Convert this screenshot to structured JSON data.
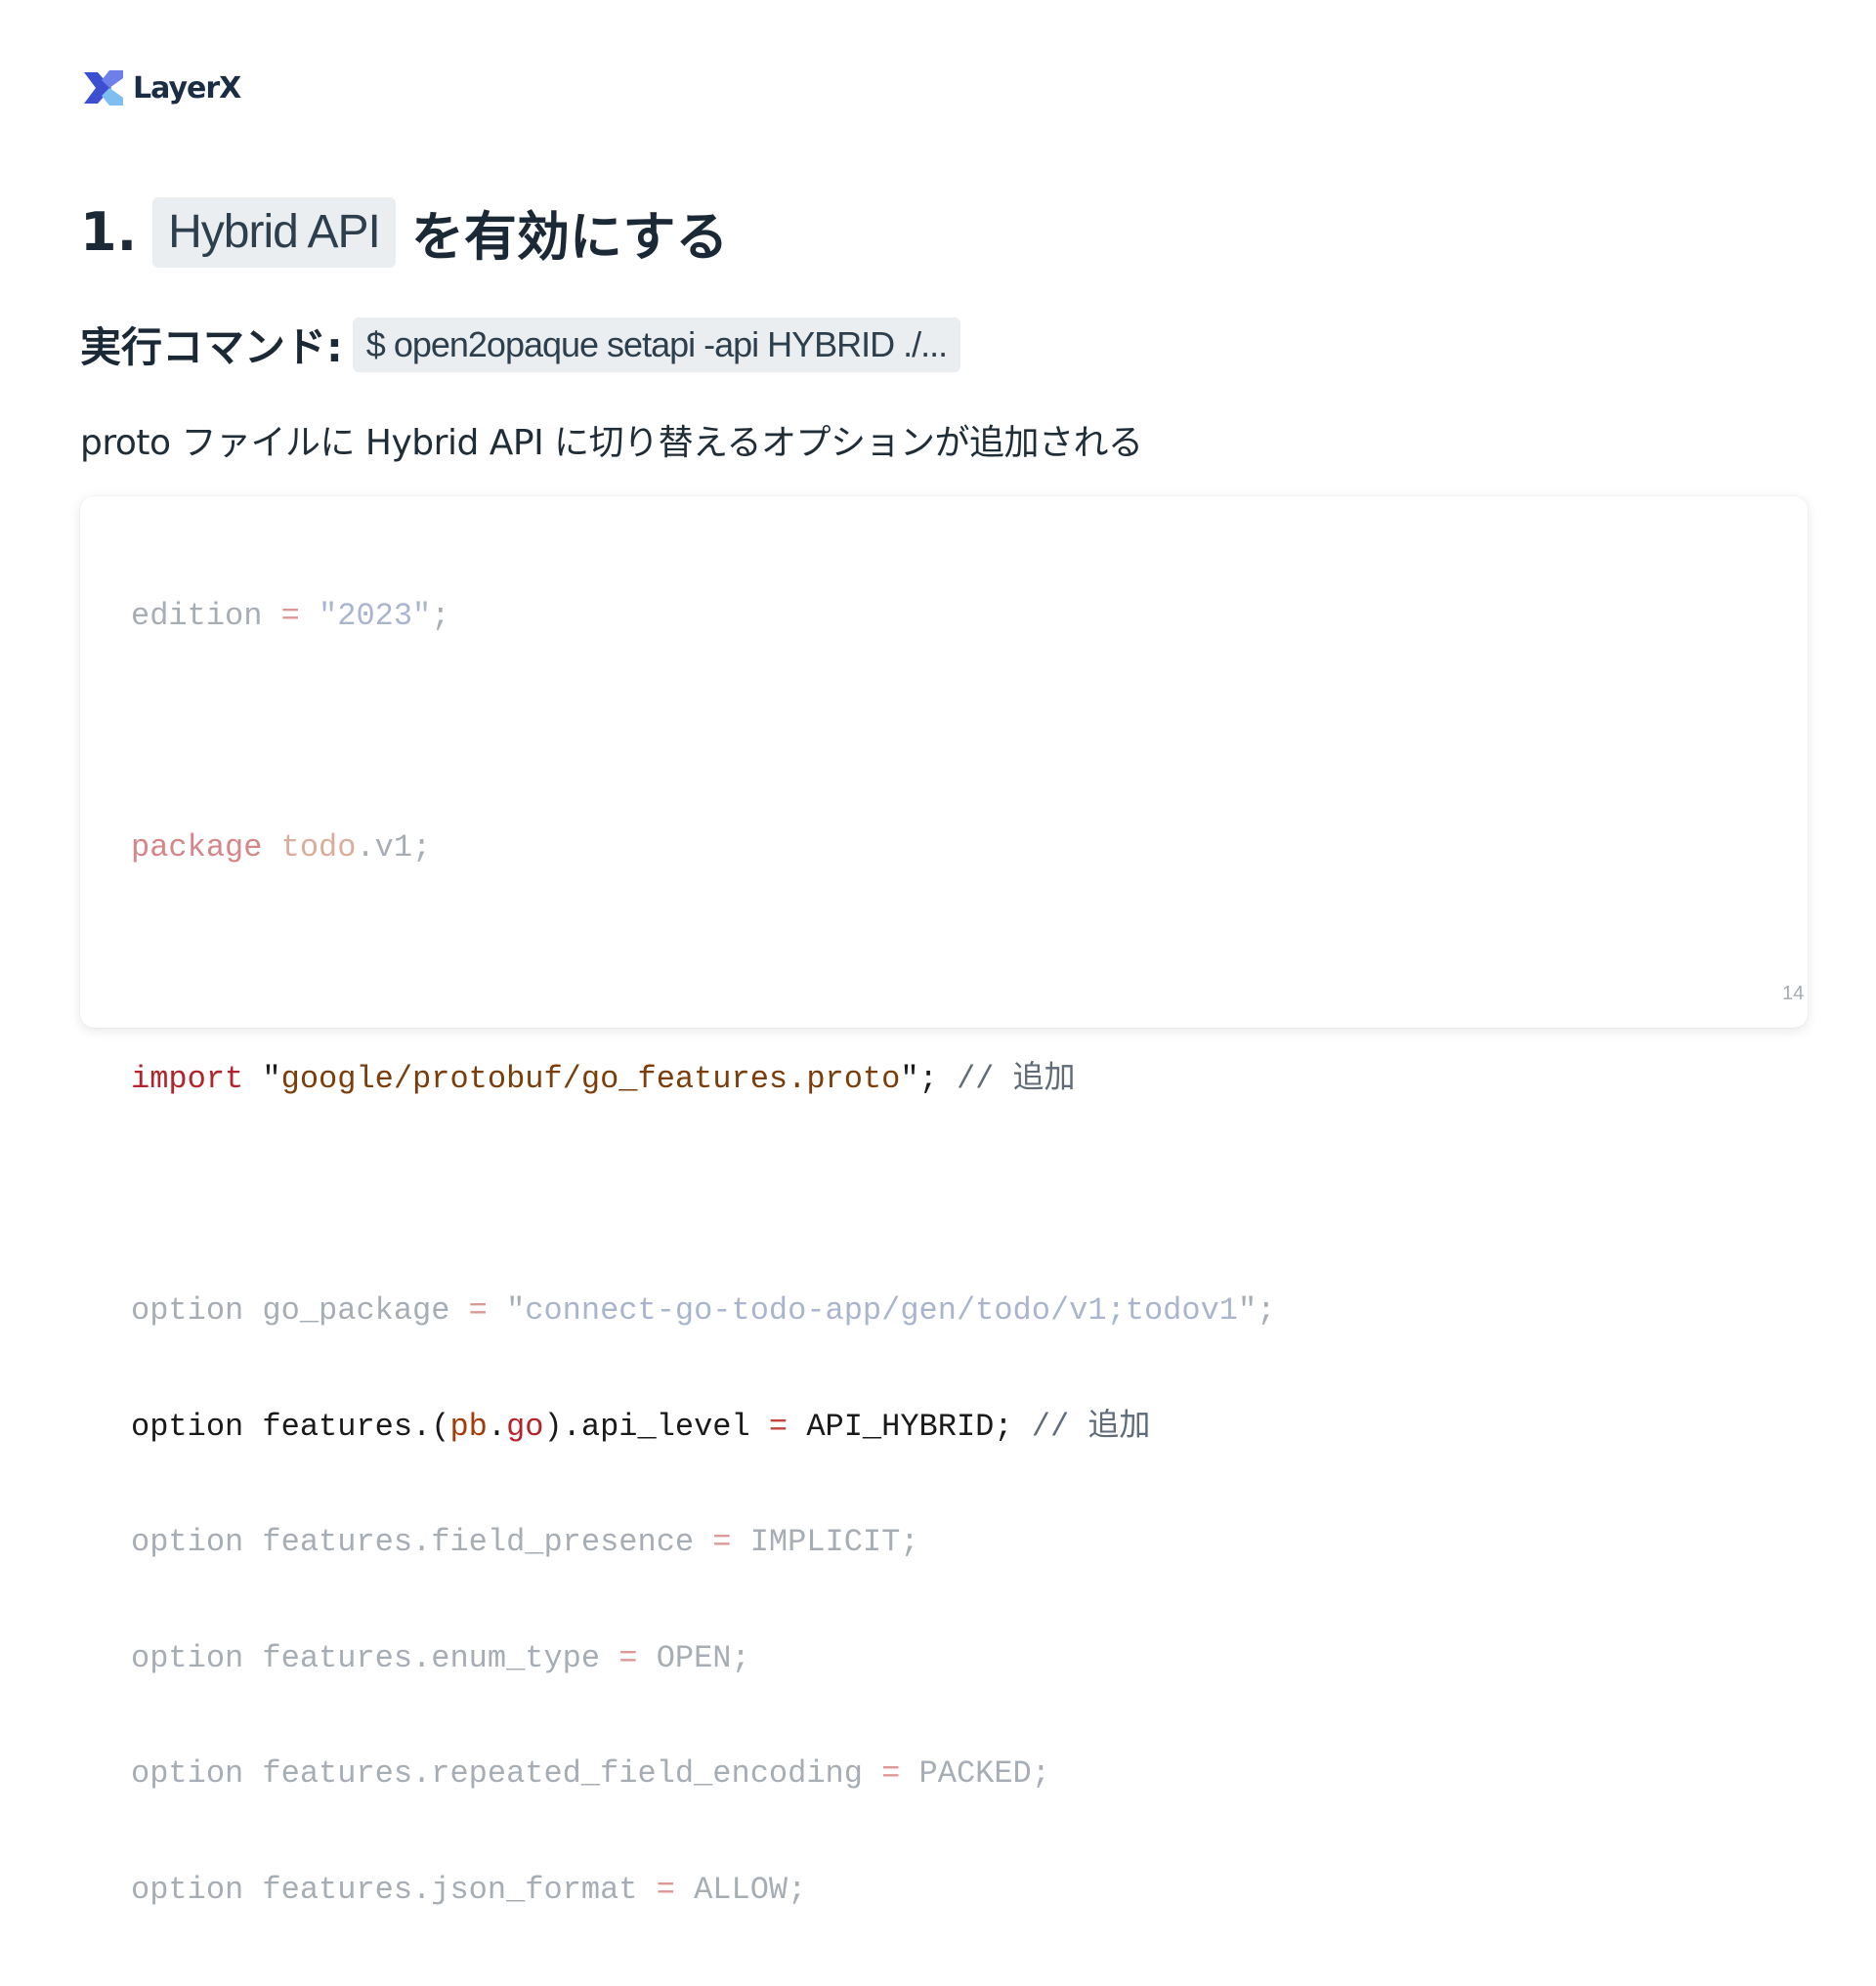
{
  "logo": {
    "text": "LayerX",
    "colors": [
      "#3d4fd1",
      "#6d7fe8",
      "#7fbef0"
    ]
  },
  "title": {
    "number": "1.",
    "code": "Hybrid API",
    "rest": "を有効にする"
  },
  "command": {
    "label": "実行コマンド:",
    "code": "$ open2opaque setapi -api HYBRID ./..."
  },
  "description": "proto ファイルに Hybrid API に切り替えるオプションが追加される",
  "code": {
    "edition": {
      "kw": "edition",
      "op": "=",
      "value": "\"2023\"",
      "end": ";"
    },
    "package": {
      "kw": "package",
      "name": "todo",
      "rest": ".v1;"
    },
    "import": {
      "kw": "import",
      "q1": "\"",
      "path": "google/protobuf/go_features.proto",
      "q2": "\"",
      "end": ";",
      "comment": "// 追加"
    },
    "go_package": {
      "kw": "option",
      "name": "go_package",
      "op": "=",
      "q1": "\"",
      "value": "connect-go-todo-app/gen/todo/v1;todov1",
      "q2": "\"",
      "end": ";"
    },
    "api_level": {
      "kw": "option",
      "pre": "features.(",
      "pb": "pb",
      "dot": ".",
      "go": "go",
      "post": ").api_level",
      "op": "=",
      "value": "API_HYBRID;",
      "comment": "// 追加"
    },
    "field_presence": {
      "kw": "option",
      "name": "features.field_presence",
      "op": "=",
      "value": "IMPLICIT;"
    },
    "enum_type": {
      "kw": "option",
      "name": "features.enum_type",
      "op": "=",
      "value": "OPEN;"
    },
    "repeated": {
      "kw": "option",
      "name": "features.repeated_field_encoding",
      "op": "=",
      "value": "PACKED;"
    },
    "json_format": {
      "kw": "option",
      "name": "features.json_format",
      "op": "=",
      "value": "ALLOW;"
    }
  },
  "page_number": "14"
}
